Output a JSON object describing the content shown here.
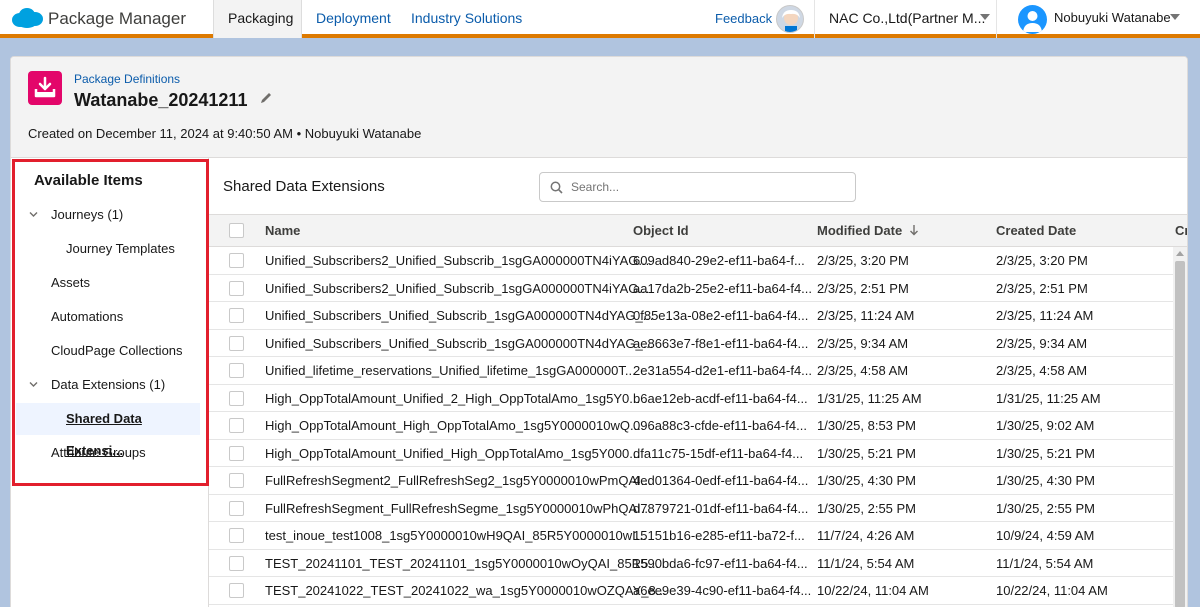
{
  "nav": {
    "app_name": "Package Manager",
    "tabs": [
      {
        "label": "Packaging"
      },
      {
        "label": "Deployment"
      },
      {
        "label": "Industry Solutions"
      }
    ],
    "feedback": "Feedback",
    "org": "NAC Co.,Ltd(Partner M...",
    "user": "Nobuyuki Watanabe",
    "accent_color": "#dd7a01"
  },
  "header": {
    "breadcrumb": "Package Definitions",
    "title": "Watanabe_20241211",
    "created": "Created on December 11, 2024 at 9:40:50 AM • Nobuyuki Watanabe"
  },
  "left": {
    "title": "Available Items",
    "items": [
      {
        "label": "Journeys (1)"
      },
      {
        "label": "Journey Templates"
      },
      {
        "label": "Assets"
      },
      {
        "label": "Automations"
      },
      {
        "label": "CloudPage Collections"
      },
      {
        "label": "Data Extensions (1)"
      },
      {
        "label": "Shared Data Extensi..."
      },
      {
        "label": "Attribute Groups"
      }
    ]
  },
  "content": {
    "title": "Shared Data Extensions",
    "search_placeholder": "Search...",
    "columns": [
      "Name",
      "Object Id",
      "Modified Date",
      "Created Date",
      "Cr"
    ],
    "rows": [
      [
        "Unified_Subscribers2_Unified_Subscrib_1sgGA000000TN4iYAG...",
        "609ad840-29e2-ef11-ba64-f...",
        "2/3/25, 3:20 PM",
        "2/3/25, 3:20 PM"
      ],
      [
        "Unified_Subscribers2_Unified_Subscrib_1sgGA000000TN4iYAG...",
        "aa17da2b-25e2-ef11-ba64-f4...",
        "2/3/25, 2:51 PM",
        "2/3/25, 2:51 PM"
      ],
      [
        "Unified_Subscribers_Unified_Subscrib_1sgGA000000TN4dYAG_...",
        "0f85e13a-08e2-ef11-ba64-f4...",
        "2/3/25, 11:24 AM",
        "2/3/25, 11:24 AM"
      ],
      [
        "Unified_Subscribers_Unified_Subscrib_1sgGA000000TN4dYAG_...",
        "ae8663e7-f8e1-ef11-ba64-f4...",
        "2/3/25, 9:34 AM",
        "2/3/25, 9:34 AM"
      ],
      [
        "Unified_lifetime_reservations_Unified_lifetime_1sgGA000000T...",
        "2e31a554-d2e1-ef11-ba64-f4...",
        "2/3/25, 4:58 AM",
        "2/3/25, 4:58 AM"
      ],
      [
        "High_OppTotalAmount_Unified_2_High_OppTotalAmo_1sg5Y0...",
        "b6ae12eb-acdf-ef11-ba64-f4...",
        "1/31/25, 11:25 AM",
        "1/31/25, 11:25 AM"
      ],
      [
        "High_OppTotalAmount_High_OppTotalAmo_1sg5Y0000010wQ...",
        "096a88c3-cfde-ef11-ba64-f4...",
        "1/30/25, 8:53 PM",
        "1/30/25, 9:02 AM"
      ],
      [
        "High_OppTotalAmount_Unified_High_OppTotalAmo_1sg5Y000...",
        "dfa11c75-15df-ef11-ba64-f4...",
        "1/30/25, 5:21 PM",
        "1/30/25, 5:21 PM"
      ],
      [
        "FullRefreshSegment2_FullRefreshSeg2_1sg5Y0000010wPmQAI...",
        "4ed01364-0edf-ef11-ba64-f4...",
        "1/30/25, 4:30 PM",
        "1/30/25, 4:30 PM"
      ],
      [
        "FullRefreshSegment_FullRefreshSegme_1sg5Y0000010wPhQAI...",
        "d7879721-01df-ef11-ba64-f4...",
        "1/30/25, 2:55 PM",
        "1/30/25, 2:55 PM"
      ],
      [
        "test_inoue_test1008_1sg5Y0000010wH9QAI_85R5Y0000010wI...",
        "15151b16-e285-ef11-ba72-f...",
        "11/7/24, 4:26 AM",
        "10/9/24, 4:59 AM"
      ],
      [
        "TEST_20241101_TEST_20241101_1sg5Y0000010wOyQAI_85R5...",
        "1590bda6-fc97-ef11-ba64-f4...",
        "11/1/24, 5:54 AM",
        "11/1/24, 5:54 AM"
      ],
      [
        "TEST_20241022_TEST_20241022_wa_1sg5Y0000010wOZQAY_8...",
        "a6ee9e39-4c90-ef11-ba64-f4...",
        "10/22/24, 11:04 AM",
        "10/22/24, 11:04 AM"
      ]
    ]
  }
}
